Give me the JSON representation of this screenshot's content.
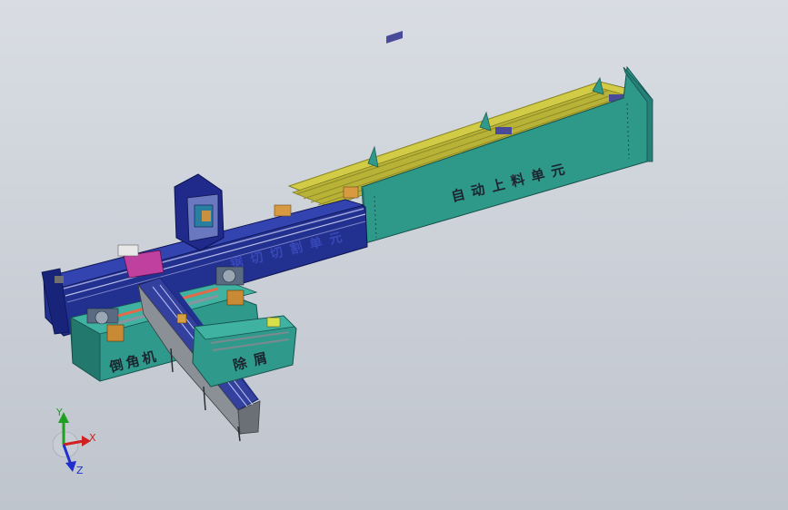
{
  "model": {
    "units": [
      {
        "id": "loader",
        "label": "自动上料单元"
      },
      {
        "id": "cutting",
        "label": "锯切切割单元"
      },
      {
        "id": "chamfer",
        "label": "倒角机"
      },
      {
        "id": "deburr",
        "label": "除屑"
      }
    ]
  },
  "triad": {
    "x_label": "X",
    "y_label": "Y",
    "z_label": "Z"
  },
  "colors": {
    "background": "#cfd4db",
    "teal_body": "#2f9a8c",
    "navy_frame": "#1f2a8a",
    "rail_yellow": "#c8c43a",
    "grey_conveyor": "#8a9096",
    "axis_x": "#d02020",
    "axis_y": "#20a020",
    "axis_z": "#2030d0"
  }
}
